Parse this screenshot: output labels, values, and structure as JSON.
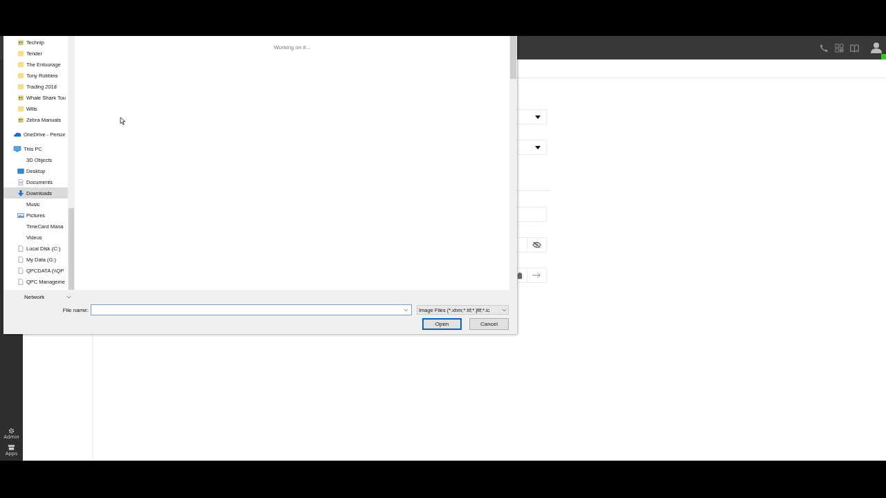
{
  "app": {
    "sidebar_items": [
      {
        "label": "Admin",
        "kind": "gear"
      },
      {
        "label": "Apps",
        "kind": "apps"
      }
    ],
    "top_icons": [
      {
        "kind": "phone"
      },
      {
        "kind": "qr"
      },
      {
        "kind": "book"
      },
      {
        "kind": "user"
      }
    ],
    "form_fields": [
      {
        "kind": "select"
      },
      {
        "kind": "select"
      },
      {
        "kind": "rule"
      },
      {
        "kind": "text"
      },
      {
        "kind": "password"
      },
      {
        "kind": "paste"
      }
    ]
  },
  "dialog": {
    "status": "Working on it...",
    "nav_folders": [
      {
        "label": "Technip",
        "kind": "shared",
        "selected": false
      },
      {
        "label": "Tender",
        "kind": "folder",
        "selected": false
      },
      {
        "label": "The Entourage",
        "kind": "folder",
        "selected": false
      },
      {
        "label": "Tony Robbins",
        "kind": "folder",
        "selected": false
      },
      {
        "label": "Trading 2018",
        "kind": "folder",
        "selected": false
      },
      {
        "label": "Whale Shark Tou",
        "kind": "shared",
        "selected": false
      },
      {
        "label": "Wills",
        "kind": "folder",
        "selected": false
      },
      {
        "label": "Zebra Manuals",
        "kind": "shared",
        "selected": false
      }
    ],
    "nav_tree": [
      {
        "label": "OneDrive - Persor",
        "kind": "cloud",
        "selected": false
      },
      {
        "label": "This PC",
        "kind": "pc",
        "selected": false,
        "children": [
          {
            "label": "3D Objects",
            "kind": "none",
            "selected": false
          },
          {
            "label": "Desktop",
            "kind": "desktop",
            "selected": false
          },
          {
            "label": "Documents",
            "kind": "documents",
            "selected": false
          },
          {
            "label": "Downloads",
            "kind": "downloads",
            "selected": true
          },
          {
            "label": "Music",
            "kind": "none",
            "selected": false
          },
          {
            "label": "Pictures",
            "kind": "pictures",
            "selected": false
          },
          {
            "label": "TimeCard Mana",
            "kind": "none",
            "selected": false
          },
          {
            "label": "Videos",
            "kind": "none",
            "selected": false
          },
          {
            "label": "Local Disk (C:)",
            "kind": "drive",
            "selected": false
          },
          {
            "label": "My Data (G:)",
            "kind": "drive",
            "selected": false
          },
          {
            "label": "QPCDATA (\\\\QP",
            "kind": "drive",
            "selected": false
          },
          {
            "label": "QPC Manageme",
            "kind": "drive",
            "selected": false
          }
        ]
      }
    ],
    "network": "Network",
    "file_name_label": "File name:",
    "file_type": "Image Files (*.xbm;*.tif;*.jfif;*.ic",
    "buttons": [
      {
        "label": "Open",
        "kind": "default"
      },
      {
        "label": "Cancel",
        "kind": "normal"
      }
    ]
  }
}
